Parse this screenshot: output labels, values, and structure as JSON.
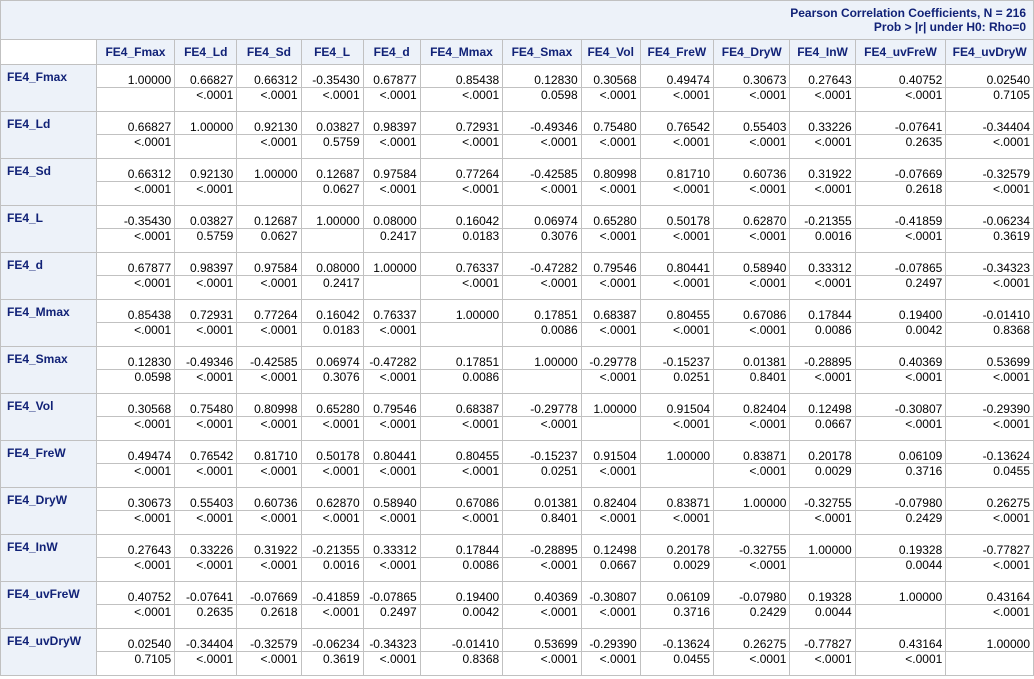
{
  "table": {
    "title_line1": "Pearson Correlation Coefficients, N = 216",
    "title_line2": "Prob > |r| under H0: Rho=0",
    "columns": [
      "FE4_Fmax",
      "FE4_Ld",
      "FE4_Sd",
      "FE4_L",
      "FE4_d",
      "FE4_Mmax",
      "FE4_Smax",
      "FE4_Vol",
      "FE4_FreW",
      "FE4_DryW",
      "FE4_InW",
      "FE4_uvFreW",
      "FE4_uvDryW"
    ],
    "rows": [
      {
        "label": "FE4_Fmax",
        "r": [
          "1.00000",
          "0.66827",
          "0.66312",
          "-0.35430",
          "0.67877",
          "0.85438",
          "0.12830",
          "0.30568",
          "0.49474",
          "0.30673",
          "0.27643",
          "0.40752",
          "0.02540"
        ],
        "p": [
          "",
          "<.0001",
          "<.0001",
          "<.0001",
          "<.0001",
          "<.0001",
          "0.0598",
          "<.0001",
          "<.0001",
          "<.0001",
          "<.0001",
          "<.0001",
          "0.7105"
        ]
      },
      {
        "label": "FE4_Ld",
        "r": [
          "0.66827",
          "1.00000",
          "0.92130",
          "0.03827",
          "0.98397",
          "0.72931",
          "-0.49346",
          "0.75480",
          "0.76542",
          "0.55403",
          "0.33226",
          "-0.07641",
          "-0.34404"
        ],
        "p": [
          "<.0001",
          "",
          "<.0001",
          "0.5759",
          "<.0001",
          "<.0001",
          "<.0001",
          "<.0001",
          "<.0001",
          "<.0001",
          "<.0001",
          "0.2635",
          "<.0001"
        ]
      },
      {
        "label": "FE4_Sd",
        "r": [
          "0.66312",
          "0.92130",
          "1.00000",
          "0.12687",
          "0.97584",
          "0.77264",
          "-0.42585",
          "0.80998",
          "0.81710",
          "0.60736",
          "0.31922",
          "-0.07669",
          "-0.32579"
        ],
        "p": [
          "<.0001",
          "<.0001",
          "",
          "0.0627",
          "<.0001",
          "<.0001",
          "<.0001",
          "<.0001",
          "<.0001",
          "<.0001",
          "<.0001",
          "0.2618",
          "<.0001"
        ]
      },
      {
        "label": "FE4_L",
        "r": [
          "-0.35430",
          "0.03827",
          "0.12687",
          "1.00000",
          "0.08000",
          "0.16042",
          "0.06974",
          "0.65280",
          "0.50178",
          "0.62870",
          "-0.21355",
          "-0.41859",
          "-0.06234"
        ],
        "p": [
          "<.0001",
          "0.5759",
          "0.0627",
          "",
          "0.2417",
          "0.0183",
          "0.3076",
          "<.0001",
          "<.0001",
          "<.0001",
          "0.0016",
          "<.0001",
          "0.3619"
        ]
      },
      {
        "label": "FE4_d",
        "r": [
          "0.67877",
          "0.98397",
          "0.97584",
          "0.08000",
          "1.00000",
          "0.76337",
          "-0.47282",
          "0.79546",
          "0.80441",
          "0.58940",
          "0.33312",
          "-0.07865",
          "-0.34323"
        ],
        "p": [
          "<.0001",
          "<.0001",
          "<.0001",
          "0.2417",
          "",
          "<.0001",
          "<.0001",
          "<.0001",
          "<.0001",
          "<.0001",
          "<.0001",
          "0.2497",
          "<.0001"
        ]
      },
      {
        "label": "FE4_Mmax",
        "r": [
          "0.85438",
          "0.72931",
          "0.77264",
          "0.16042",
          "0.76337",
          "1.00000",
          "0.17851",
          "0.68387",
          "0.80455",
          "0.67086",
          "0.17844",
          "0.19400",
          "-0.01410"
        ],
        "p": [
          "<.0001",
          "<.0001",
          "<.0001",
          "0.0183",
          "<.0001",
          "",
          "0.0086",
          "<.0001",
          "<.0001",
          "<.0001",
          "0.0086",
          "0.0042",
          "0.8368"
        ]
      },
      {
        "label": "FE4_Smax",
        "r": [
          "0.12830",
          "-0.49346",
          "-0.42585",
          "0.06974",
          "-0.47282",
          "0.17851",
          "1.00000",
          "-0.29778",
          "-0.15237",
          "0.01381",
          "-0.28895",
          "0.40369",
          "0.53699"
        ],
        "p": [
          "0.0598",
          "<.0001",
          "<.0001",
          "0.3076",
          "<.0001",
          "0.0086",
          "",
          "<.0001",
          "0.0251",
          "0.8401",
          "<.0001",
          "<.0001",
          "<.0001"
        ]
      },
      {
        "label": "FE4_Vol",
        "r": [
          "0.30568",
          "0.75480",
          "0.80998",
          "0.65280",
          "0.79546",
          "0.68387",
          "-0.29778",
          "1.00000",
          "0.91504",
          "0.82404",
          "0.12498",
          "-0.30807",
          "-0.29390"
        ],
        "p": [
          "<.0001",
          "<.0001",
          "<.0001",
          "<.0001",
          "<.0001",
          "<.0001",
          "<.0001",
          "",
          "<.0001",
          "<.0001",
          "0.0667",
          "<.0001",
          "<.0001"
        ]
      },
      {
        "label": "FE4_FreW",
        "r": [
          "0.49474",
          "0.76542",
          "0.81710",
          "0.50178",
          "0.80441",
          "0.80455",
          "-0.15237",
          "0.91504",
          "1.00000",
          "0.83871",
          "0.20178",
          "0.06109",
          "-0.13624"
        ],
        "p": [
          "<.0001",
          "<.0001",
          "<.0001",
          "<.0001",
          "<.0001",
          "<.0001",
          "0.0251",
          "<.0001",
          "",
          "<.0001",
          "0.0029",
          "0.3716",
          "0.0455"
        ]
      },
      {
        "label": "FE4_DryW",
        "r": [
          "0.30673",
          "0.55403",
          "0.60736",
          "0.62870",
          "0.58940",
          "0.67086",
          "0.01381",
          "0.82404",
          "0.83871",
          "1.00000",
          "-0.32755",
          "-0.07980",
          "0.26275"
        ],
        "p": [
          "<.0001",
          "<.0001",
          "<.0001",
          "<.0001",
          "<.0001",
          "<.0001",
          "0.8401",
          "<.0001",
          "<.0001",
          "",
          "<.0001",
          "0.2429",
          "<.0001"
        ]
      },
      {
        "label": "FE4_InW",
        "r": [
          "0.27643",
          "0.33226",
          "0.31922",
          "-0.21355",
          "0.33312",
          "0.17844",
          "-0.28895",
          "0.12498",
          "0.20178",
          "-0.32755",
          "1.00000",
          "0.19328",
          "-0.77827"
        ],
        "p": [
          "<.0001",
          "<.0001",
          "<.0001",
          "0.0016",
          "<.0001",
          "0.0086",
          "<.0001",
          "0.0667",
          "0.0029",
          "<.0001",
          "",
          "0.0044",
          "<.0001"
        ]
      },
      {
        "label": "FE4_uvFreW",
        "r": [
          "0.40752",
          "-0.07641",
          "-0.07669",
          "-0.41859",
          "-0.07865",
          "0.19400",
          "0.40369",
          "-0.30807",
          "0.06109",
          "-0.07980",
          "0.19328",
          "1.00000",
          "0.43164"
        ],
        "p": [
          "<.0001",
          "0.2635",
          "0.2618",
          "<.0001",
          "0.2497",
          "0.0042",
          "<.0001",
          "<.0001",
          "0.3716",
          "0.2429",
          "0.0044",
          "",
          "<.0001"
        ]
      },
      {
        "label": "FE4_uvDryW",
        "r": [
          "0.02540",
          "-0.34404",
          "-0.32579",
          "-0.06234",
          "-0.34323",
          "-0.01410",
          "0.53699",
          "-0.29390",
          "-0.13624",
          "0.26275",
          "-0.77827",
          "0.43164",
          "1.00000"
        ],
        "p": [
          "0.7105",
          "<.0001",
          "<.0001",
          "0.3619",
          "<.0001",
          "0.8368",
          "<.0001",
          "<.0001",
          "0.0455",
          "<.0001",
          "<.0001",
          "<.0001",
          ""
        ]
      }
    ]
  }
}
